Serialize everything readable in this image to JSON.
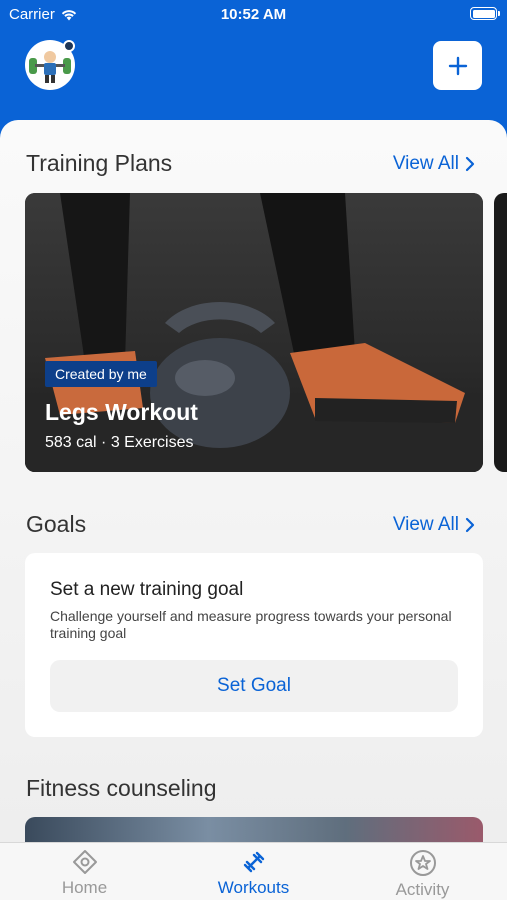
{
  "status_bar": {
    "carrier": "Carrier",
    "time": "10:52 AM"
  },
  "header": {
    "avatar_icon": "user-avatar-icon",
    "add_icon": "plus-icon"
  },
  "training_plans": {
    "title": "Training Plans",
    "view_all": "View All",
    "card": {
      "badge": "Created by me",
      "title": "Legs Workout",
      "meta": "583 cal · 3 Exercises"
    }
  },
  "goals": {
    "title": "Goals",
    "view_all": "View All",
    "card": {
      "title": "Set a new training goal",
      "description": "Challenge yourself and measure progress towards your personal training goal",
      "button": "Set Goal"
    }
  },
  "fitness": {
    "title": "Fitness counseling"
  },
  "tabs": [
    {
      "label": "Home",
      "icon": "home-diamond-icon",
      "active": false
    },
    {
      "label": "Workouts",
      "icon": "dumbbell-icon",
      "active": true
    },
    {
      "label": "Activity",
      "icon": "star-badge-icon",
      "active": false
    }
  ],
  "colors": {
    "accent": "#0a63d6",
    "badge": "#0d3f8a"
  }
}
